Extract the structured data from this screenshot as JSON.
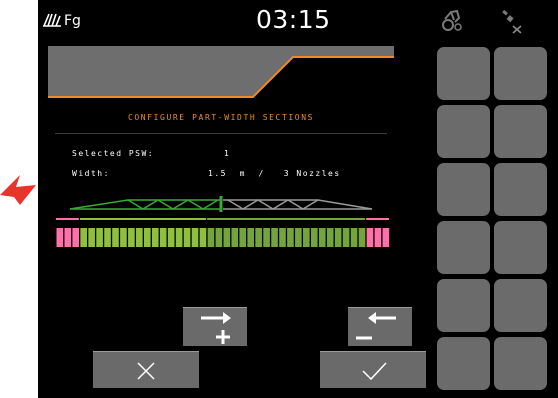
{
  "status_bar": {
    "mode_label": "Fg",
    "time": "03:15",
    "tractor_icon": "tractor-icon",
    "satellite_icon": "satellite-off-icon",
    "sprayer_icon": "sprayer-mode-icon"
  },
  "screen": {
    "title": "CONFIGURE PART-WIDTH SECTIONS",
    "selected_psw_label": "Selected PSW:",
    "selected_psw_value": "1",
    "width_label": "Width:",
    "width_value": "1.5  m  /   3 Nozzles"
  },
  "boom": {
    "active_side_color": "#3aaa35",
    "inactive_side_color": "#9a9a9a",
    "section_colors": {
      "edge": "#ff6fa8",
      "selected": "#8fbf3f",
      "other": "#74a53c"
    }
  },
  "buttons": {
    "add_right_icon": "arrow-right-plus-icon",
    "remove_left_icon": "arrow-left-minus-icon",
    "cancel_icon": "close-icon",
    "confirm_icon": "checkmark-icon"
  },
  "colors": {
    "accent_orange": "#f08a24",
    "header_gray": "#6e6e6e",
    "button_gray": "#6a6a6a",
    "annotation_red": "#e8352b"
  }
}
